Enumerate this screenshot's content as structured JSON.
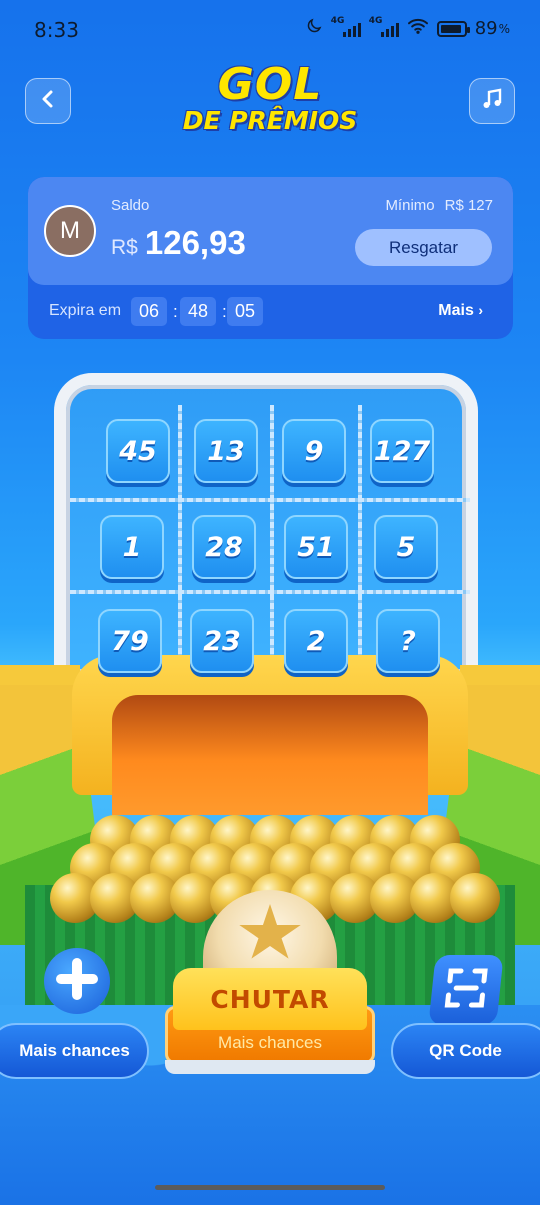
{
  "status_bar": {
    "time": "8:33",
    "network1": "4G",
    "network2": "4G",
    "battery_percent": "89",
    "battery_level": 0.89
  },
  "header": {
    "title_line1": "GOL",
    "title_line2": "DE PRÊMIOS",
    "back_icon": "chevron-left-icon",
    "music_icon": "music-note-icon"
  },
  "balance": {
    "avatar_initial": "M",
    "label": "Saldo",
    "currency": "R$",
    "amount": "126,93",
    "minimum_label": "Mínimo",
    "minimum_value": "R$ 127",
    "redeem_button": "Resgatar",
    "expires_label": "Expira em",
    "timer_h": "06",
    "timer_m": "48",
    "timer_s": "05",
    "more_link": "Mais"
  },
  "board": {
    "cells": [
      "45",
      "13",
      "9",
      "127",
      "1",
      "28",
      "51",
      "5",
      "79",
      "23",
      "2",
      "?"
    ]
  },
  "controls": {
    "more_chances_label": "Mais chances",
    "kick_label": "CHUTAR",
    "kick_sub_label": "Mais chances",
    "qr_label": "QR Code"
  },
  "colors": {
    "title_yellow": "#ffe600",
    "card_blue": "#4c87f2",
    "kick_orange": "#ff9a12"
  }
}
